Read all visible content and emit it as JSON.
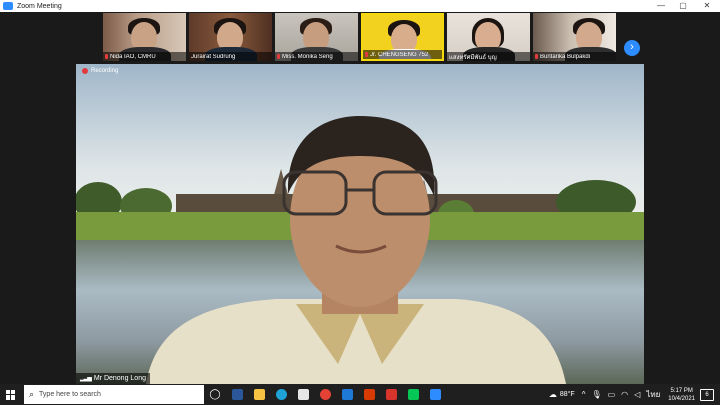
{
  "window": {
    "title": "Zoom Meeting",
    "minimize": "—",
    "maximize": "▢",
    "close": "✕"
  },
  "gallery": {
    "participants": [
      {
        "name": "Nida IAO, CMRU"
      },
      {
        "name": "Jurairat Sudrung"
      },
      {
        "name": "Miss. Monika Seng"
      },
      {
        "name": "Jr. CHENGSENG 752"
      },
      {
        "name": "แสงทรัศมีพันธ์ บุญ"
      },
      {
        "name": "Buntarika Bulpakdi"
      }
    ],
    "next_icon": "›"
  },
  "main_video": {
    "recording_label": "Recording",
    "speaker_name": "Mr Denong Long",
    "signal_icon": "▂▃▅"
  },
  "taskbar": {
    "search_placeholder": "Type here to search",
    "search_icon": "⌕",
    "weather": "88°F",
    "language": "ไทย",
    "time": "5:17 PM",
    "date": "10/4/2021",
    "notification_count": "6",
    "colors": {
      "word": "#2b579a",
      "explorer": "#f6c343",
      "edge": "#1fa3d6",
      "store": "#e6e6e6",
      "chrome": "#e54236",
      "mail": "#1d78d6",
      "office": "#d83b01",
      "acrobat": "#d9342b",
      "line": "#06c755",
      "zoom": "#2d8cff"
    }
  }
}
